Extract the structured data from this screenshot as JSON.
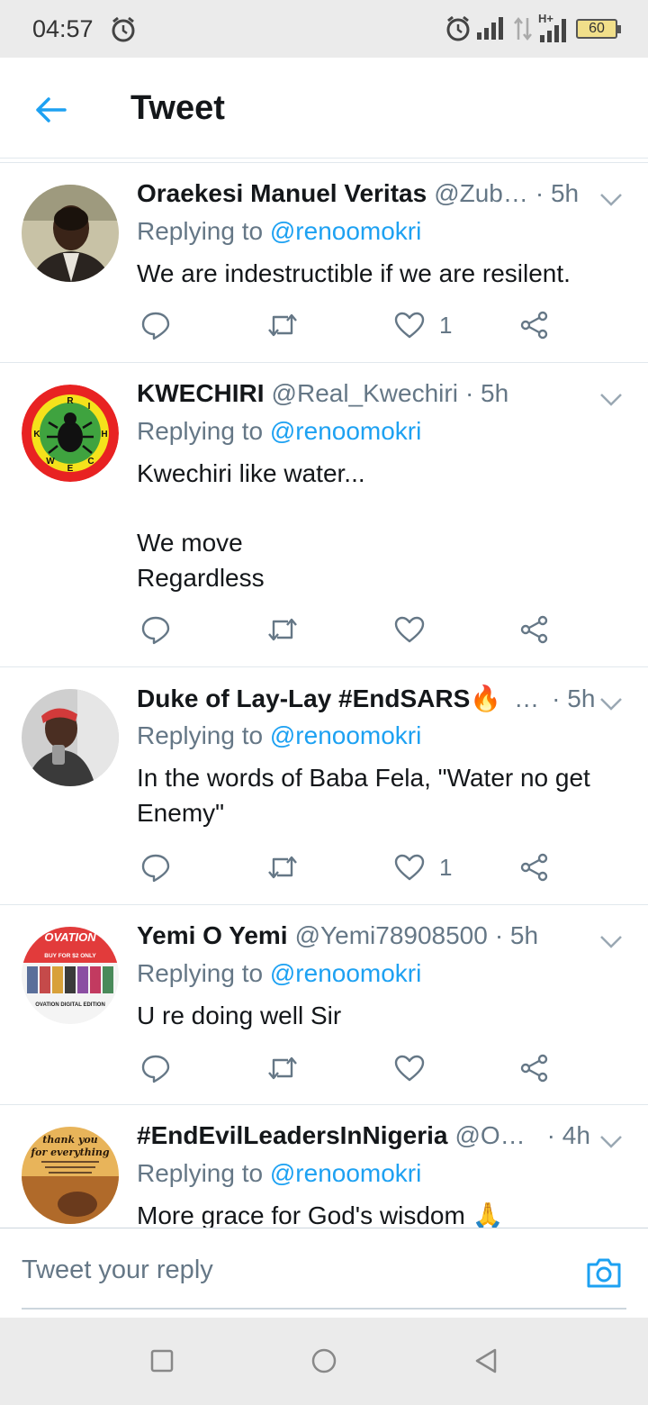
{
  "status_bar": {
    "time": "04:57",
    "network_label": "H+",
    "battery": "60"
  },
  "header": {
    "title": "Tweet",
    "back_icon": "back-arrow-icon"
  },
  "tweets": [
    {
      "name": "Oraekesi Manuel Veritas",
      "handle": "@Zub…",
      "time": "· 5h",
      "replying_prefix": "Replying to ",
      "replying_to": "@renoomokri",
      "text": "We are indestructible if we are resilent.",
      "likes": "1"
    },
    {
      "name": "KWECHIRI",
      "handle": "@Real_Kwechiri",
      "time": "· 5h",
      "replying_prefix": "Replying to ",
      "replying_to": "@renoomokri",
      "text": "Kwechiri like water...\n\nWe move\nRegardless",
      "likes": "",
      "logo_letters": [
        "R",
        "I",
        "K",
        "H",
        "W",
        "E",
        "C"
      ]
    },
    {
      "name": "Duke of Lay-Lay #EndSARS🔥",
      "handle": "…",
      "time": "· 5h",
      "replying_prefix": "Replying to ",
      "replying_to": "@renoomokri",
      "text": "In the words of Baba Fela, \"Water no get Enemy\"",
      "likes": "1"
    },
    {
      "name": "Yemi O Yemi",
      "handle": "@Yemi78908500",
      "time": "· 5h",
      "replying_prefix": "Replying to ",
      "replying_to": "@renoomokri",
      "text": "U re doing well Sir",
      "likes": "",
      "logo_text": [
        "OVATION",
        "BUY FOR $2 ONLY",
        "OVATION DIGITAL EDITION"
      ]
    },
    {
      "name": "#EndEvilLeadersInNigeria",
      "handle": "@O…",
      "time": "· 4h",
      "replying_prefix": "Replying to ",
      "replying_to": "@renoomokri",
      "text": "More grace for God's wisdom 🙏",
      "likes": "",
      "logo_text": [
        "thank you",
        "for everything"
      ]
    }
  ],
  "composer": {
    "placeholder": "Tweet your reply"
  },
  "colors": {
    "accent": "#1da1f2",
    "secondary_text": "#657786",
    "primary_text": "#14171a",
    "divider": "#e1e8ed"
  }
}
